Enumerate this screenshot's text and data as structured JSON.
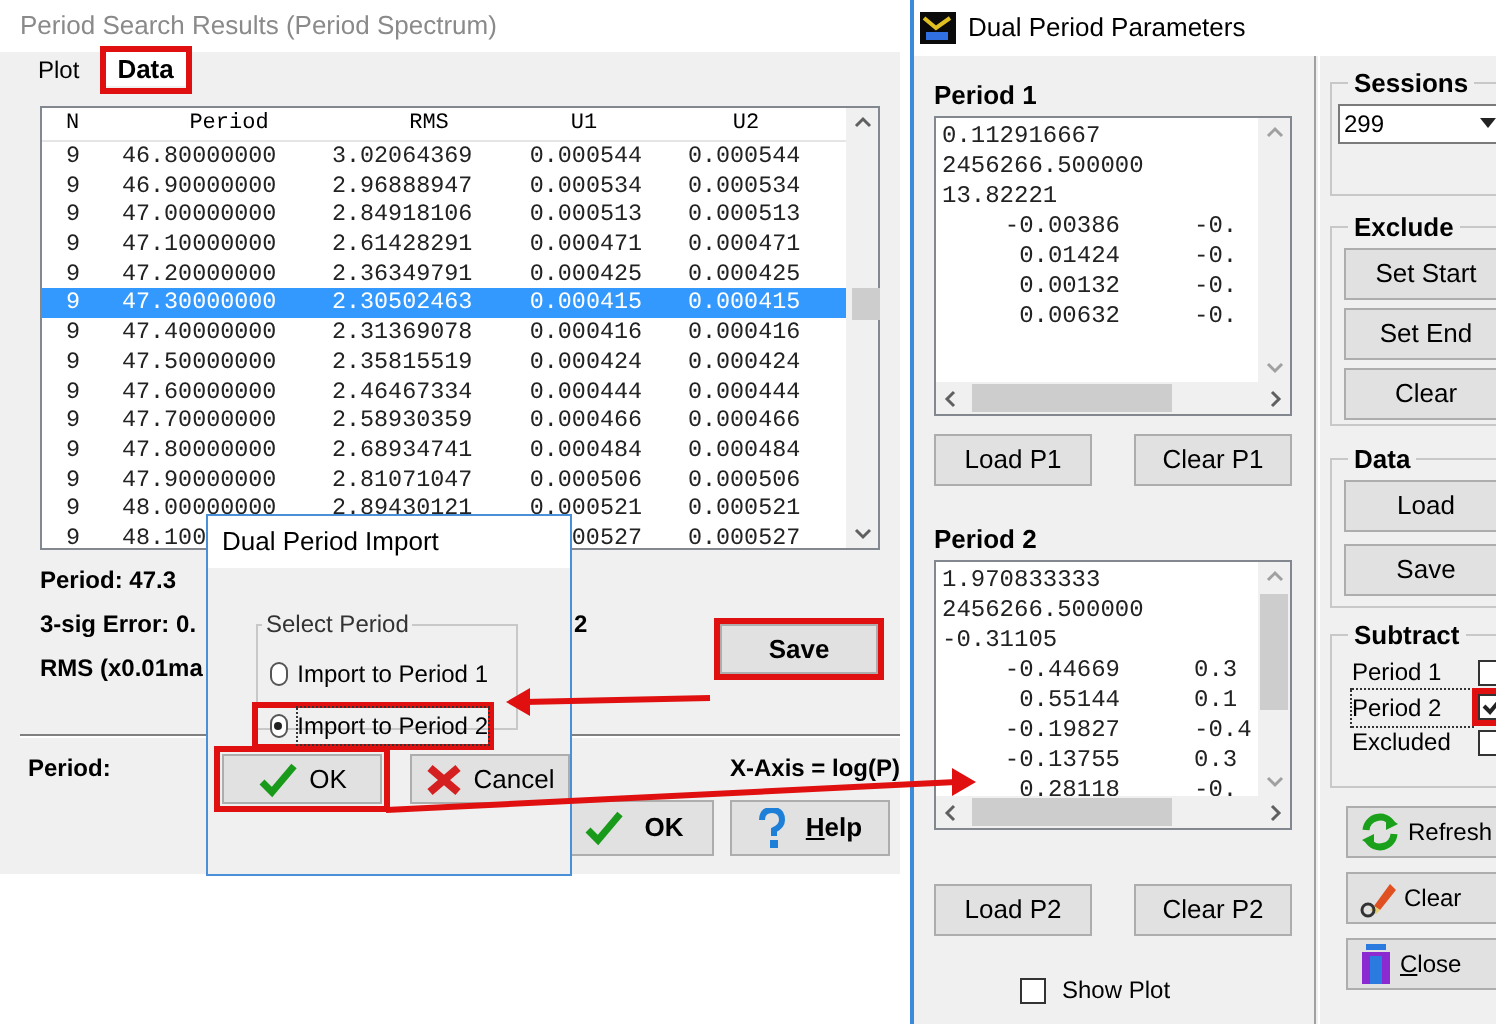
{
  "left_window": {
    "title": "Period Search Results (Period Spectrum)",
    "tabs": [
      {
        "label": "Plot",
        "selected": false,
        "highlighted": false
      },
      {
        "label": "Data",
        "selected": true,
        "highlighted": true
      }
    ],
    "table": {
      "columns": [
        "N",
        "Period",
        "RMS",
        "U1",
        "U2"
      ],
      "rows": [
        {
          "cells": [
            "9",
            "46.80000000",
            "3.02064369",
            "0.000544",
            "0.000544"
          ],
          "selected": false
        },
        {
          "cells": [
            "9",
            "46.90000000",
            "2.96888947",
            "0.000534",
            "0.000534"
          ],
          "selected": false
        },
        {
          "cells": [
            "9",
            "47.00000000",
            "2.84918106",
            "0.000513",
            "0.000513"
          ],
          "selected": false
        },
        {
          "cells": [
            "9",
            "47.10000000",
            "2.61428291",
            "0.000471",
            "0.000471"
          ],
          "selected": false
        },
        {
          "cells": [
            "9",
            "47.20000000",
            "2.36349791",
            "0.000425",
            "0.000425"
          ],
          "selected": false
        },
        {
          "cells": [
            "9",
            "47.30000000",
            "2.30502463",
            "0.000415",
            "0.000415"
          ],
          "selected": true
        },
        {
          "cells": [
            "9",
            "47.40000000",
            "2.31369078",
            "0.000416",
            "0.000416"
          ],
          "selected": false
        },
        {
          "cells": [
            "9",
            "47.50000000",
            "2.35815519",
            "0.000424",
            "0.000424"
          ],
          "selected": false
        },
        {
          "cells": [
            "9",
            "47.60000000",
            "2.46467334",
            "0.000444",
            "0.000444"
          ],
          "selected": false
        },
        {
          "cells": [
            "9",
            "47.70000000",
            "2.58930359",
            "0.000466",
            "0.000466"
          ],
          "selected": false
        },
        {
          "cells": [
            "9",
            "47.80000000",
            "2.68934741",
            "0.000484",
            "0.000484"
          ],
          "selected": false
        },
        {
          "cells": [
            "9",
            "47.90000000",
            "2.81071047",
            "0.000506",
            "0.000506"
          ],
          "selected": false
        },
        {
          "cells": [
            "9",
            "48.00000000",
            "2.89430121",
            "0.000521",
            "0.000521"
          ],
          "selected": false
        },
        {
          "cells": [
            "9",
            "48.100",
            null,
            "00527",
            "0.000527"
          ],
          "selected": false
        }
      ]
    },
    "summary": [
      {
        "text": "Period: 47.3"
      },
      {
        "text": "3-sig Error: 0.",
        "tail": "2"
      },
      {
        "text": "RMS (x0.01ma"
      }
    ],
    "save_button": {
      "label": "Save",
      "highlighted": true
    },
    "period_label": "Period:",
    "x_axis_label": "X-Axis = log(P)",
    "buttons": [
      {
        "label": "OK",
        "kind": "ok"
      },
      {
        "label": "Help",
        "kind": "help"
      }
    ]
  },
  "dialog": {
    "title": "Dual Period Import",
    "group_label": "Select Period",
    "options": [
      {
        "label": "Import to Period 1",
        "selected": false,
        "focused": false,
        "highlighted": false
      },
      {
        "label": "Import to Period 2",
        "selected": true,
        "focused": true,
        "highlighted": true
      }
    ],
    "buttons": [
      {
        "label": "OK",
        "kind": "ok",
        "highlighted": true
      },
      {
        "label": "Cancel",
        "kind": "cancel",
        "highlighted": false
      }
    ]
  },
  "right_window": {
    "title": "Dual Period Parameters",
    "period_boxes": [
      {
        "label": "Period 1",
        "lines": [
          {
            "cells": [
              "0.112916667"
            ]
          },
          {
            "cells": [
              "2456266.500000"
            ]
          },
          {
            "cells": [
              "13.82221"
            ]
          },
          {
            "cells": [
              "-0.00386",
              "-0."
            ]
          },
          {
            "cells": [
              "0.01424",
              "-0."
            ]
          },
          {
            "cells": [
              "0.00132",
              "-0."
            ]
          },
          {
            "cells": [
              "0.00632",
              "-0."
            ]
          }
        ],
        "buttons": [
          "Load P1",
          "Clear P1"
        ]
      },
      {
        "label": "Period 2",
        "lines": [
          {
            "cells": [
              "1.970833333"
            ]
          },
          {
            "cells": [
              "2456266.500000"
            ]
          },
          {
            "cells": [
              "-0.31105"
            ]
          },
          {
            "cells": [
              "-0.44669",
              "0.3"
            ]
          },
          {
            "cells": [
              "0.55144",
              "0.1"
            ]
          },
          {
            "cells": [
              "-0.19827",
              "-0.4"
            ]
          },
          {
            "cells": [
              "-0.13755",
              "0.3"
            ]
          },
          {
            "cells": [
              "0.28118",
              "-0."
            ]
          }
        ],
        "buttons": [
          "Load P2",
          "Clear P2"
        ]
      }
    ],
    "show_plot": {
      "label": "Show Plot",
      "checked": false
    },
    "sessions": {
      "label": "Sessions",
      "value": "299"
    },
    "exclude": {
      "label": "Exclude",
      "buttons": [
        "Set Start",
        "Set End",
        "Clear"
      ]
    },
    "data": {
      "label": "Data",
      "buttons": [
        "Load",
        "Save"
      ]
    },
    "subtract": {
      "label": "Subtract",
      "items": [
        {
          "label": "Period 1",
          "checked": false,
          "focused": false,
          "highlighted": false
        },
        {
          "label": "Period 2",
          "checked": true,
          "focused": true,
          "highlighted": true
        },
        {
          "label": "Excluded",
          "checked": false,
          "focused": false,
          "highlighted": false
        }
      ]
    },
    "action_buttons": [
      {
        "label": "Refresh",
        "kind": "refresh"
      },
      {
        "label": "Clear",
        "kind": "clear"
      },
      {
        "label": "Close",
        "kind": "close"
      }
    ]
  }
}
